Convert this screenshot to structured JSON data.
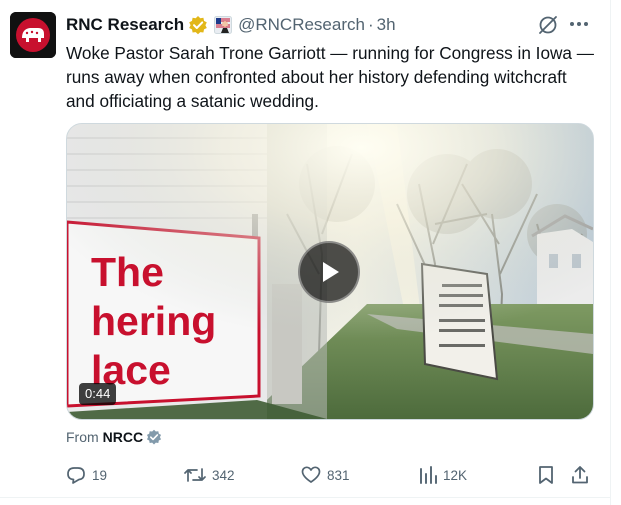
{
  "author": {
    "name": "RNC Research",
    "handle": "@RNCResearch",
    "separator": "·",
    "time": "3h"
  },
  "tweet": {
    "text": "Woke Pastor Sarah Trone Garriott — running for Congress in Iowa — runs away when confronted about her history defending witchcraft and officiating a satanic wedding."
  },
  "media": {
    "sign_lines": [
      "The",
      "hering",
      "lace"
    ],
    "duration": "0:44"
  },
  "source": {
    "prefix": "From",
    "name": "NRCC"
  },
  "actions": {
    "replies": "19",
    "reposts": "342",
    "likes": "831",
    "views": "12K"
  },
  "colors": {
    "brand_red": "#c8102e",
    "verified_gold": "#e2b719",
    "verified_gray": "#829aab",
    "muted_text": "#536471"
  },
  "icons": [
    "rnc-logo-icon",
    "gold-verified-icon",
    "affiliate-badge-icon",
    "grok-icon",
    "more-icon",
    "play-icon",
    "gray-verified-icon",
    "reply-icon",
    "repost-icon",
    "like-icon",
    "views-icon",
    "bookmark-icon",
    "share-icon"
  ]
}
